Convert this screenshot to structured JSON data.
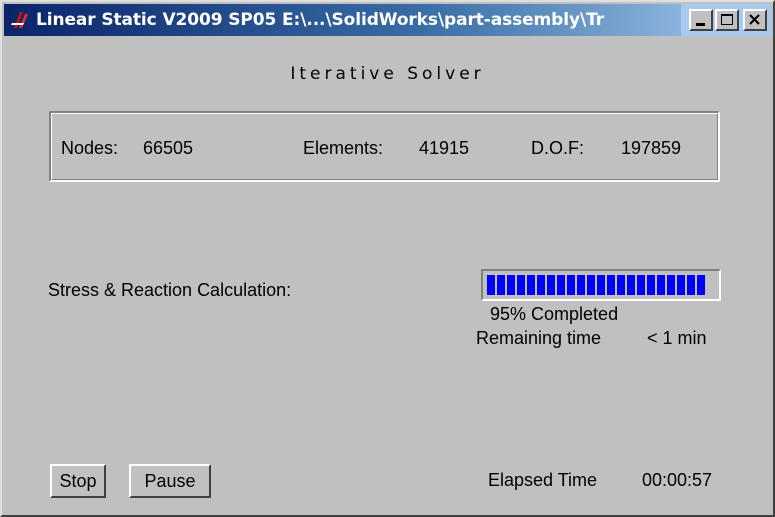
{
  "window": {
    "title": "Linear Static V2009 SP05 E:\\...\\SolidWorks\\part-assembly\\Tr",
    "app_icon": "solidworks-icon",
    "controls": [
      "minimize-icon",
      "maximize-icon",
      "close-icon"
    ]
  },
  "heading": "Iterative Solver",
  "stats": {
    "nodes_label": "Nodes:",
    "nodes_value": "66505",
    "elements_label": "Elements:",
    "elements_value": "41915",
    "dof_label": "D.O.F:",
    "dof_value": "197859"
  },
  "task": {
    "label": "Stress & Reaction Calculation:",
    "progress_fraction": 0.95,
    "progress_color": "#0000ff",
    "completed_text": "95% Completed",
    "remaining_label": "Remaining time",
    "remaining_value": "< 1 min"
  },
  "footer": {
    "stop_label": "Stop",
    "pause_label": "Pause",
    "elapsed_label": "Elapsed Time",
    "elapsed_value": "00:00:57"
  }
}
